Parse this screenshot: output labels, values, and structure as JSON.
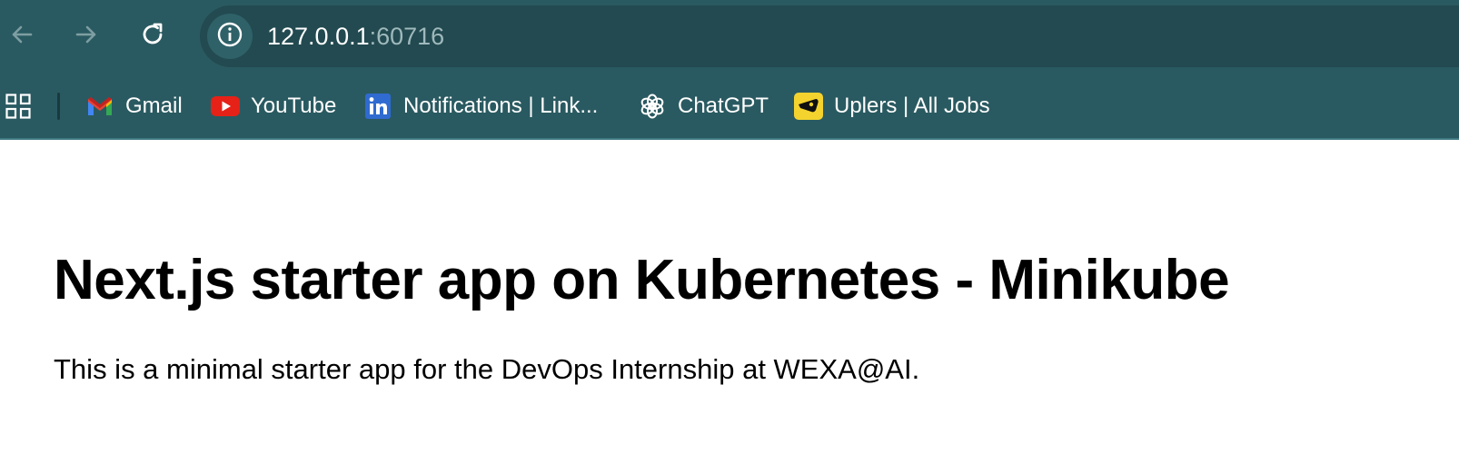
{
  "browser": {
    "nav": {
      "back_icon": "arrow-left-icon",
      "forward_icon": "arrow-right-icon",
      "reload_icon": "reload-icon"
    },
    "address_bar": {
      "info_icon": "info-icon",
      "host": "127.0.0.1",
      "port": ":60716"
    },
    "bookmarks": [
      {
        "label": "Gmail",
        "icon": "gmail-icon"
      },
      {
        "label": "YouTube",
        "icon": "youtube-icon"
      },
      {
        "label": "Notifications | Link...",
        "icon": "linkedin-icon"
      },
      {
        "label": "ChatGPT",
        "icon": "chatgpt-icon"
      },
      {
        "label": "Uplers | All Jobs",
        "icon": "uplers-icon"
      }
    ],
    "colors": {
      "chrome_bg": "#2a5a61",
      "omnibox_bg": "#224a50"
    }
  },
  "page": {
    "title": "Next.js starter app on Kubernetes - Minikube",
    "description": "This is a minimal starter app for the DevOps Internship at WEXA@AI."
  }
}
